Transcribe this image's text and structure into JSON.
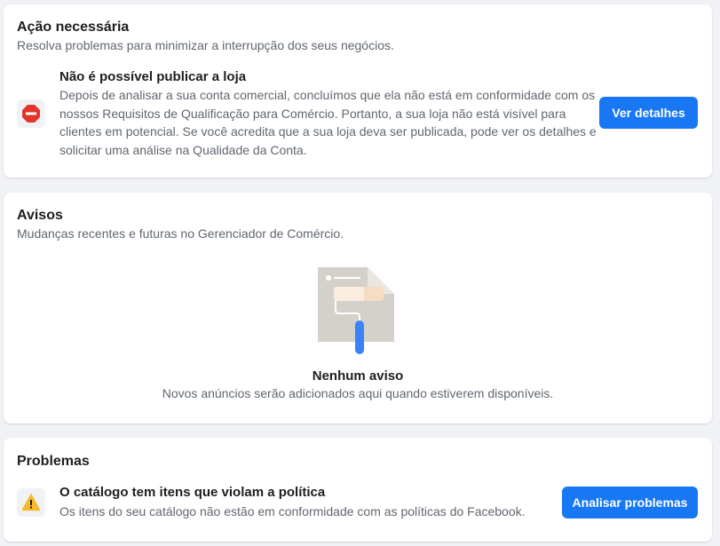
{
  "action_required": {
    "title": "Ação necessária",
    "subtitle": "Resolva problemas para minimizar a interrupção dos seus negócios.",
    "item": {
      "icon": "no-entry-icon",
      "title": "Não é possível publicar a loja",
      "body": "Depois de analisar a sua conta comercial, concluímos que ela não está em conformidade com os nossos Requisitos de Qualificação para Comércio. Portanto, a sua loja não está visível para clientes em potencial. Se você acredita que a sua loja deva ser publicada, pode ver os detalhes e solicitar uma análise na Qualidade da Conta.",
      "button_label": "Ver detalhes"
    }
  },
  "notices": {
    "title": "Avisos",
    "subtitle": "Mudanças recentes e futuras no Gerenciador de Comércio.",
    "illustration": "paint-roller-illustration",
    "empty_title": "Nenhum aviso",
    "empty_body": "Novos anúncios serão adicionados aqui quando estiverem disponíveis."
  },
  "problems": {
    "title": "Problemas",
    "item": {
      "icon": "warning-icon",
      "title": "O catálogo tem itens que violam a política",
      "body": "Os itens do seu catálogo não estão em conformidade com as políticas do Facebook.",
      "button_label": "Analisar problemas"
    }
  },
  "colors": {
    "primary": "#1877f2",
    "error": "#e4352b",
    "warning": "#f7b928",
    "background": "#f0f2f5"
  }
}
